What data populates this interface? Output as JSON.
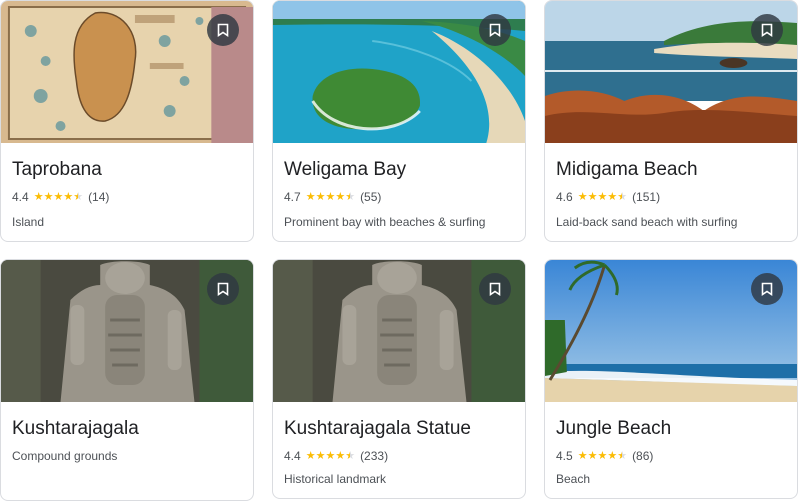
{
  "cards": [
    {
      "title": "Taprobana",
      "rating": "4.4",
      "stars": 4.4,
      "reviews": "(14)",
      "description": "Island",
      "save_icon": "bookmark-icon"
    },
    {
      "title": "Weligama Bay",
      "rating": "4.7",
      "stars": 4.7,
      "reviews": "(55)",
      "description": "Prominent bay with beaches & surfing",
      "save_icon": "bookmark-icon"
    },
    {
      "title": "Midigama Beach",
      "rating": "4.6",
      "stars": 4.6,
      "reviews": "(151)",
      "description": "Laid-back sand beach with surfing",
      "save_icon": "bookmark-icon"
    },
    {
      "title": "Kushtarajagala",
      "rating": "",
      "stars": 0,
      "reviews": "",
      "description": "Compound grounds",
      "save_icon": "bookmark-icon"
    },
    {
      "title": "Kushtarajagala Statue",
      "rating": "4.4",
      "stars": 4.4,
      "reviews": "(233)",
      "description": "Historical landmark",
      "save_icon": "bookmark-icon"
    },
    {
      "title": "Jungle Beach",
      "rating": "4.5",
      "stars": 4.5,
      "reviews": "(86)",
      "description": "Beach",
      "save_icon": "bookmark-icon"
    }
  ],
  "colors": {
    "star": "#fbbc04",
    "border": "#dadce0",
    "title": "#202124",
    "text": "#4d5156"
  }
}
